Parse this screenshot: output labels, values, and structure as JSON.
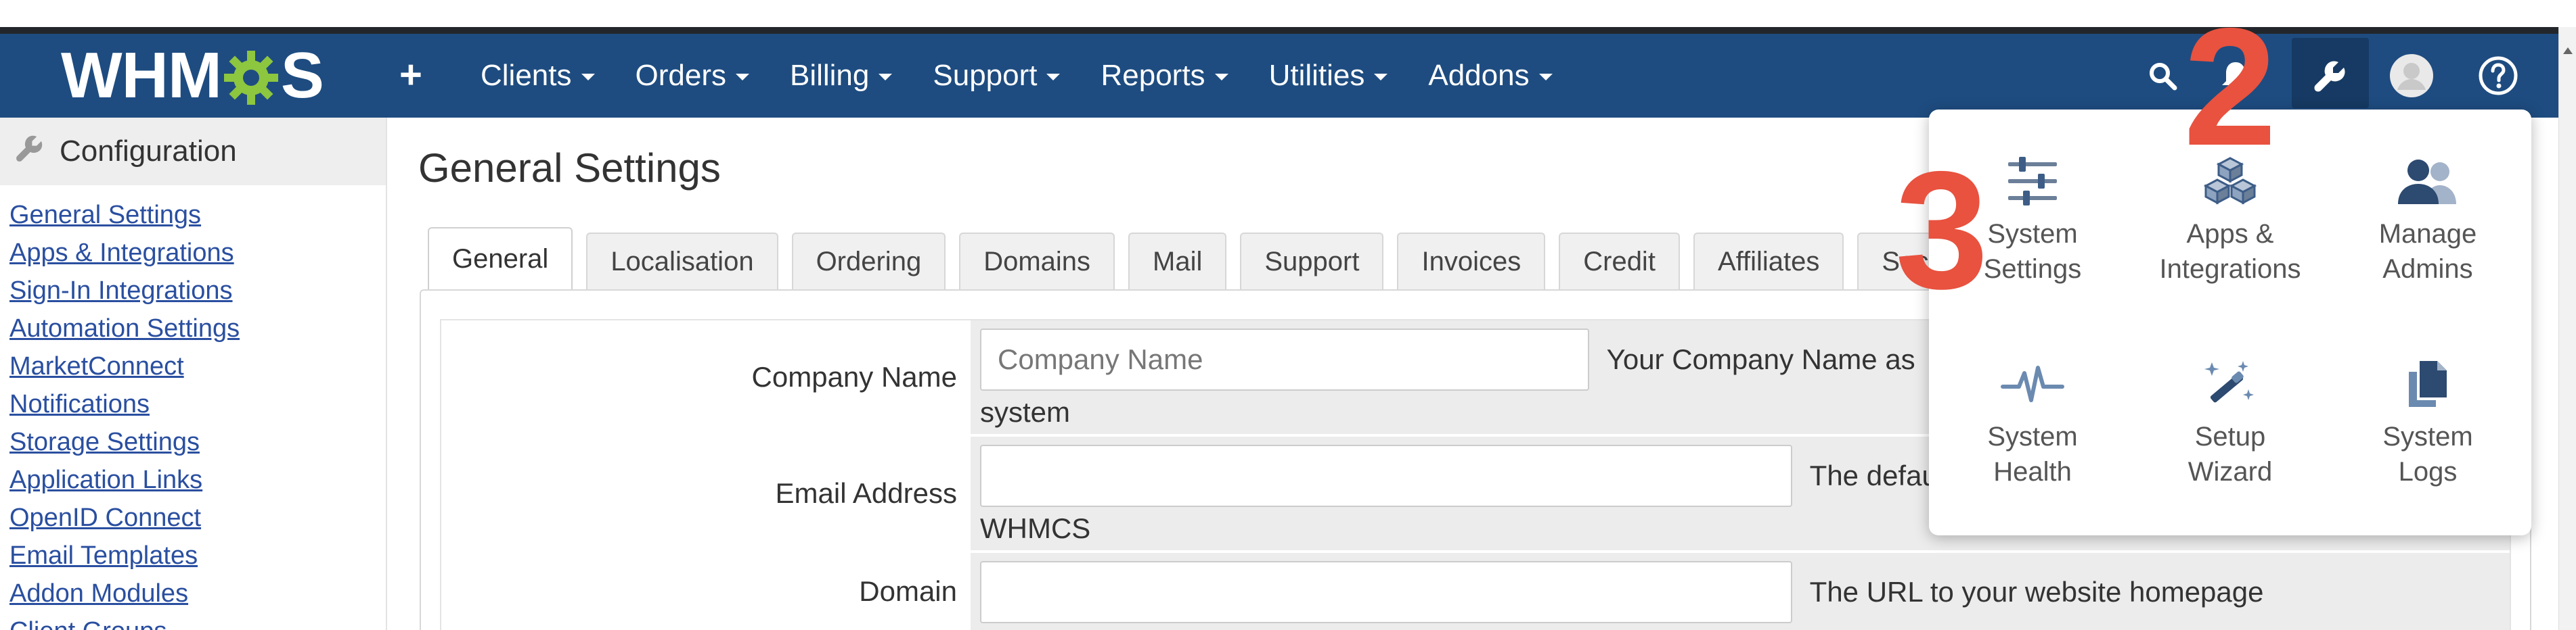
{
  "app": {
    "logo": "WHMCS",
    "colors": {
      "navbar": "#1e4c80",
      "accent_gear": "#8dc63f",
      "link": "#2a4fa0",
      "step_marker": "#e8523f"
    }
  },
  "navbar": {
    "add_icon": "plus-icon",
    "menu": [
      {
        "label": "Clients"
      },
      {
        "label": "Orders"
      },
      {
        "label": "Billing"
      },
      {
        "label": "Support"
      },
      {
        "label": "Reports"
      },
      {
        "label": "Utilities"
      },
      {
        "label": "Addons"
      }
    ],
    "right_icons": [
      "search-icon",
      "notifications-icon",
      "wrench-icon",
      "avatar-icon",
      "help-icon"
    ]
  },
  "sidebar": {
    "title": "Configuration",
    "links": [
      "General Settings",
      "Apps & Integrations",
      "Sign-In Integrations",
      "Automation Settings",
      "MarketConnect",
      "Notifications",
      "Storage Settings",
      "Application Links",
      "OpenID Connect",
      "Email Templates",
      "Addon Modules",
      "Client Groups"
    ]
  },
  "main": {
    "title": "General Settings",
    "tabs": [
      "General",
      "Localisation",
      "Ordering",
      "Domains",
      "Mail",
      "Support",
      "Invoices",
      "Credit",
      "Affiliates",
      "Secu"
    ],
    "active_tab": "General",
    "fields": {
      "company_name": {
        "label": "Company Name",
        "placeholder": "Company Name",
        "hint": "Your Company Name as",
        "subline": "system"
      },
      "email_address": {
        "label": "Email Address",
        "value": "",
        "hint": "The defau",
        "subline": "WHMCS"
      },
      "domain": {
        "label": "Domain",
        "value": "",
        "hint": "The URL to your website homepage"
      }
    }
  },
  "dropdown": {
    "items": [
      {
        "line1": "System",
        "line2": "Settings",
        "icon": "sliders-icon"
      },
      {
        "line1": "Apps &",
        "line2": "Integrations",
        "icon": "cubes-icon"
      },
      {
        "line1": "Manage",
        "line2": "Admins",
        "icon": "users-icon"
      },
      {
        "line1": "System",
        "line2": "Health",
        "icon": "heartbeat-icon"
      },
      {
        "line1": "Setup",
        "line2": "Wizard",
        "icon": "magic-wand-icon"
      },
      {
        "line1": "System",
        "line2": "Logs",
        "icon": "copy-icon"
      }
    ]
  },
  "annotations": {
    "step_2": "2",
    "step_3": "3"
  }
}
